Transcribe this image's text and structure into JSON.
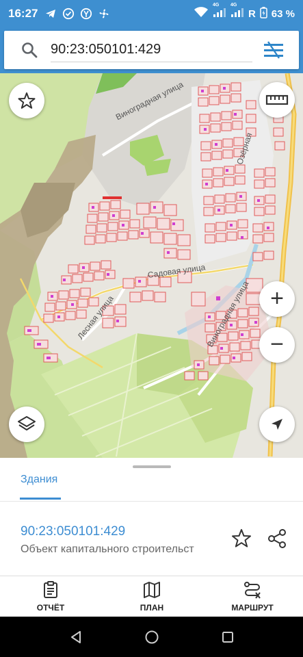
{
  "status_bar": {
    "time": "16:27",
    "network_a": "4G",
    "network_b": "4G",
    "roaming": "R",
    "battery": "63 %",
    "background_color": "#3e8fd0"
  },
  "search": {
    "value": "90:23:050101:429",
    "icon": "search-icon",
    "filter_icon": "filter-icon"
  },
  "map": {
    "streets": [
      "Виноградная улица",
      "Садовая улица",
      "Лесная улица",
      "Виноградная улица",
      "Озёрная"
    ],
    "buttons": {
      "favorites": "star-outline-icon",
      "ruler": "ruler-icon",
      "zoom_in": "+",
      "zoom_out": "−",
      "layers": "layers-icon",
      "locate": "navigation-arrow-icon"
    }
  },
  "sheet": {
    "tab_label": "Здания",
    "result_title": "90:23:050101:429",
    "result_subtitle": "Объект капитального строительст",
    "accent_color": "#3d8dd2"
  },
  "bottom_nav": {
    "items": [
      {
        "label": "ОТЧЁТ",
        "icon": "clipboard-icon"
      },
      {
        "label": "ПЛАН",
        "icon": "map-icon"
      },
      {
        "label": "МАРШРУТ",
        "icon": "route-icon"
      }
    ]
  }
}
